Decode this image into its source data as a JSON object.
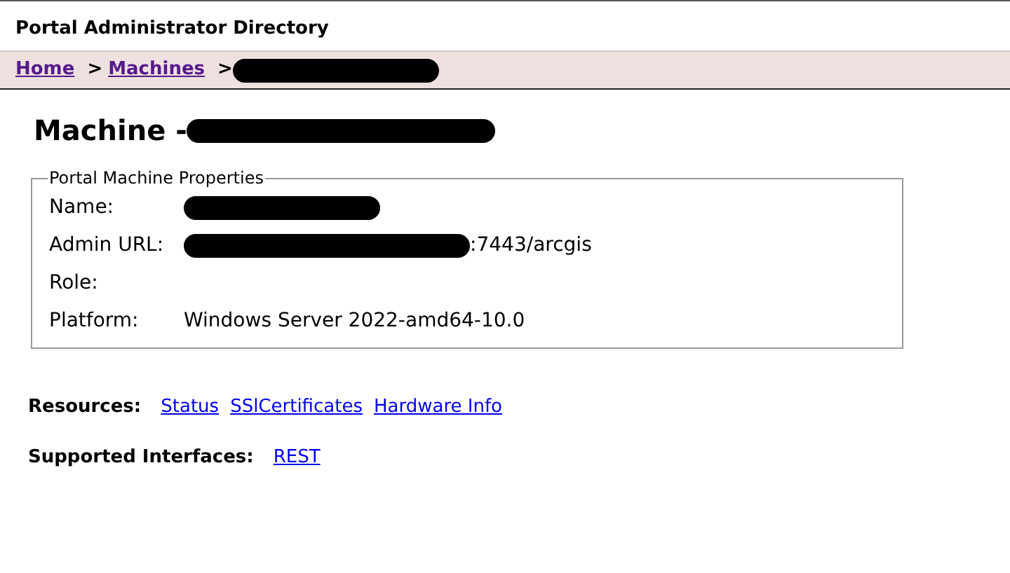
{
  "header": {
    "title": "Portal Administrator Directory"
  },
  "breadcrumb": {
    "links": [
      {
        "label": "Home"
      },
      {
        "label": "Machines"
      }
    ],
    "separators": [
      ">",
      ">"
    ]
  },
  "heading": "Machine -",
  "properties": {
    "legend": "Portal Machine Properties",
    "rows": [
      {
        "label": "Name:",
        "redacted": true
      },
      {
        "label": "Admin URL:",
        "redacted": true,
        "value": ":7443/arcgis"
      },
      {
        "label": "Role:",
        "redacted": false
      },
      {
        "label": "Platform:",
        "redacted": false,
        "value": "Windows Server 2022-amd64-10.0"
      }
    ]
  },
  "resources": {
    "label": "Resources:",
    "links": [
      "Status",
      "SSlCertificates",
      "Hardware Info"
    ]
  },
  "interfaces": {
    "label": "Supported Interfaces:",
    "links": [
      "REST"
    ]
  }
}
